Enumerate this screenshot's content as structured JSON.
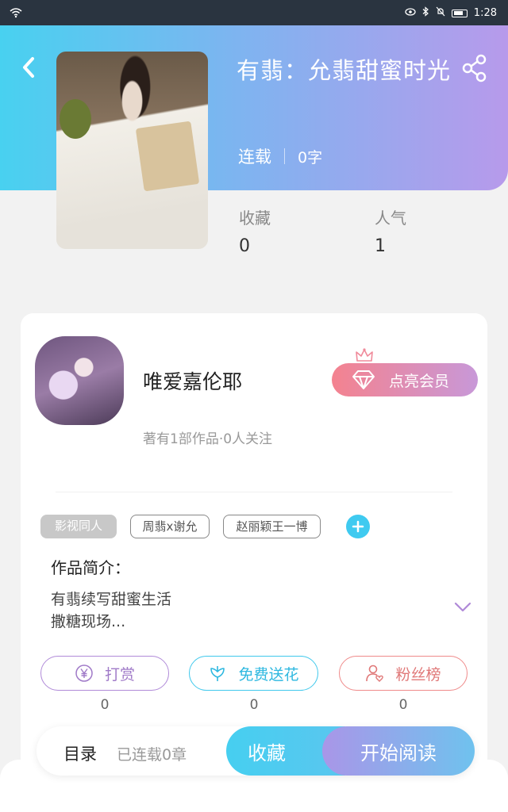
{
  "status_bar": {
    "time": "1:28"
  },
  "book": {
    "title": "有翡：允翡甜蜜时光",
    "status": "连载",
    "word_count": "0字",
    "stats": [
      {
        "label": "收藏",
        "value": "0"
      },
      {
        "label": "人气",
        "value": "1"
      }
    ]
  },
  "author": {
    "name": "唯爱嘉伦耶",
    "meta": "著有1部作品·0人关注",
    "vip_label": "点亮会员"
  },
  "tags": [
    "影视同人",
    "周翡x谢允",
    "赵丽颖王一博"
  ],
  "intro": {
    "heading": "作品简介：",
    "lines": [
      "有翡续写甜蜜生活",
      "撒糖现场..."
    ]
  },
  "actions": [
    {
      "label": "打赏",
      "icon": "yen-icon",
      "count": "0"
    },
    {
      "label": "免费送花",
      "icon": "flower-icon",
      "count": "0"
    },
    {
      "label": "粉丝榜",
      "icon": "fans-icon",
      "count": "0"
    }
  ],
  "bottom": {
    "toc_label": "目录",
    "chapters_label": "已连载0章",
    "collect_label": "收藏",
    "read_label": "开始阅读"
  },
  "colors": {
    "hero_start": "#48d1f0",
    "hero_end": "#b79aeb",
    "vip_start": "#f4828f",
    "accent_blue": "#3fcaf0"
  }
}
